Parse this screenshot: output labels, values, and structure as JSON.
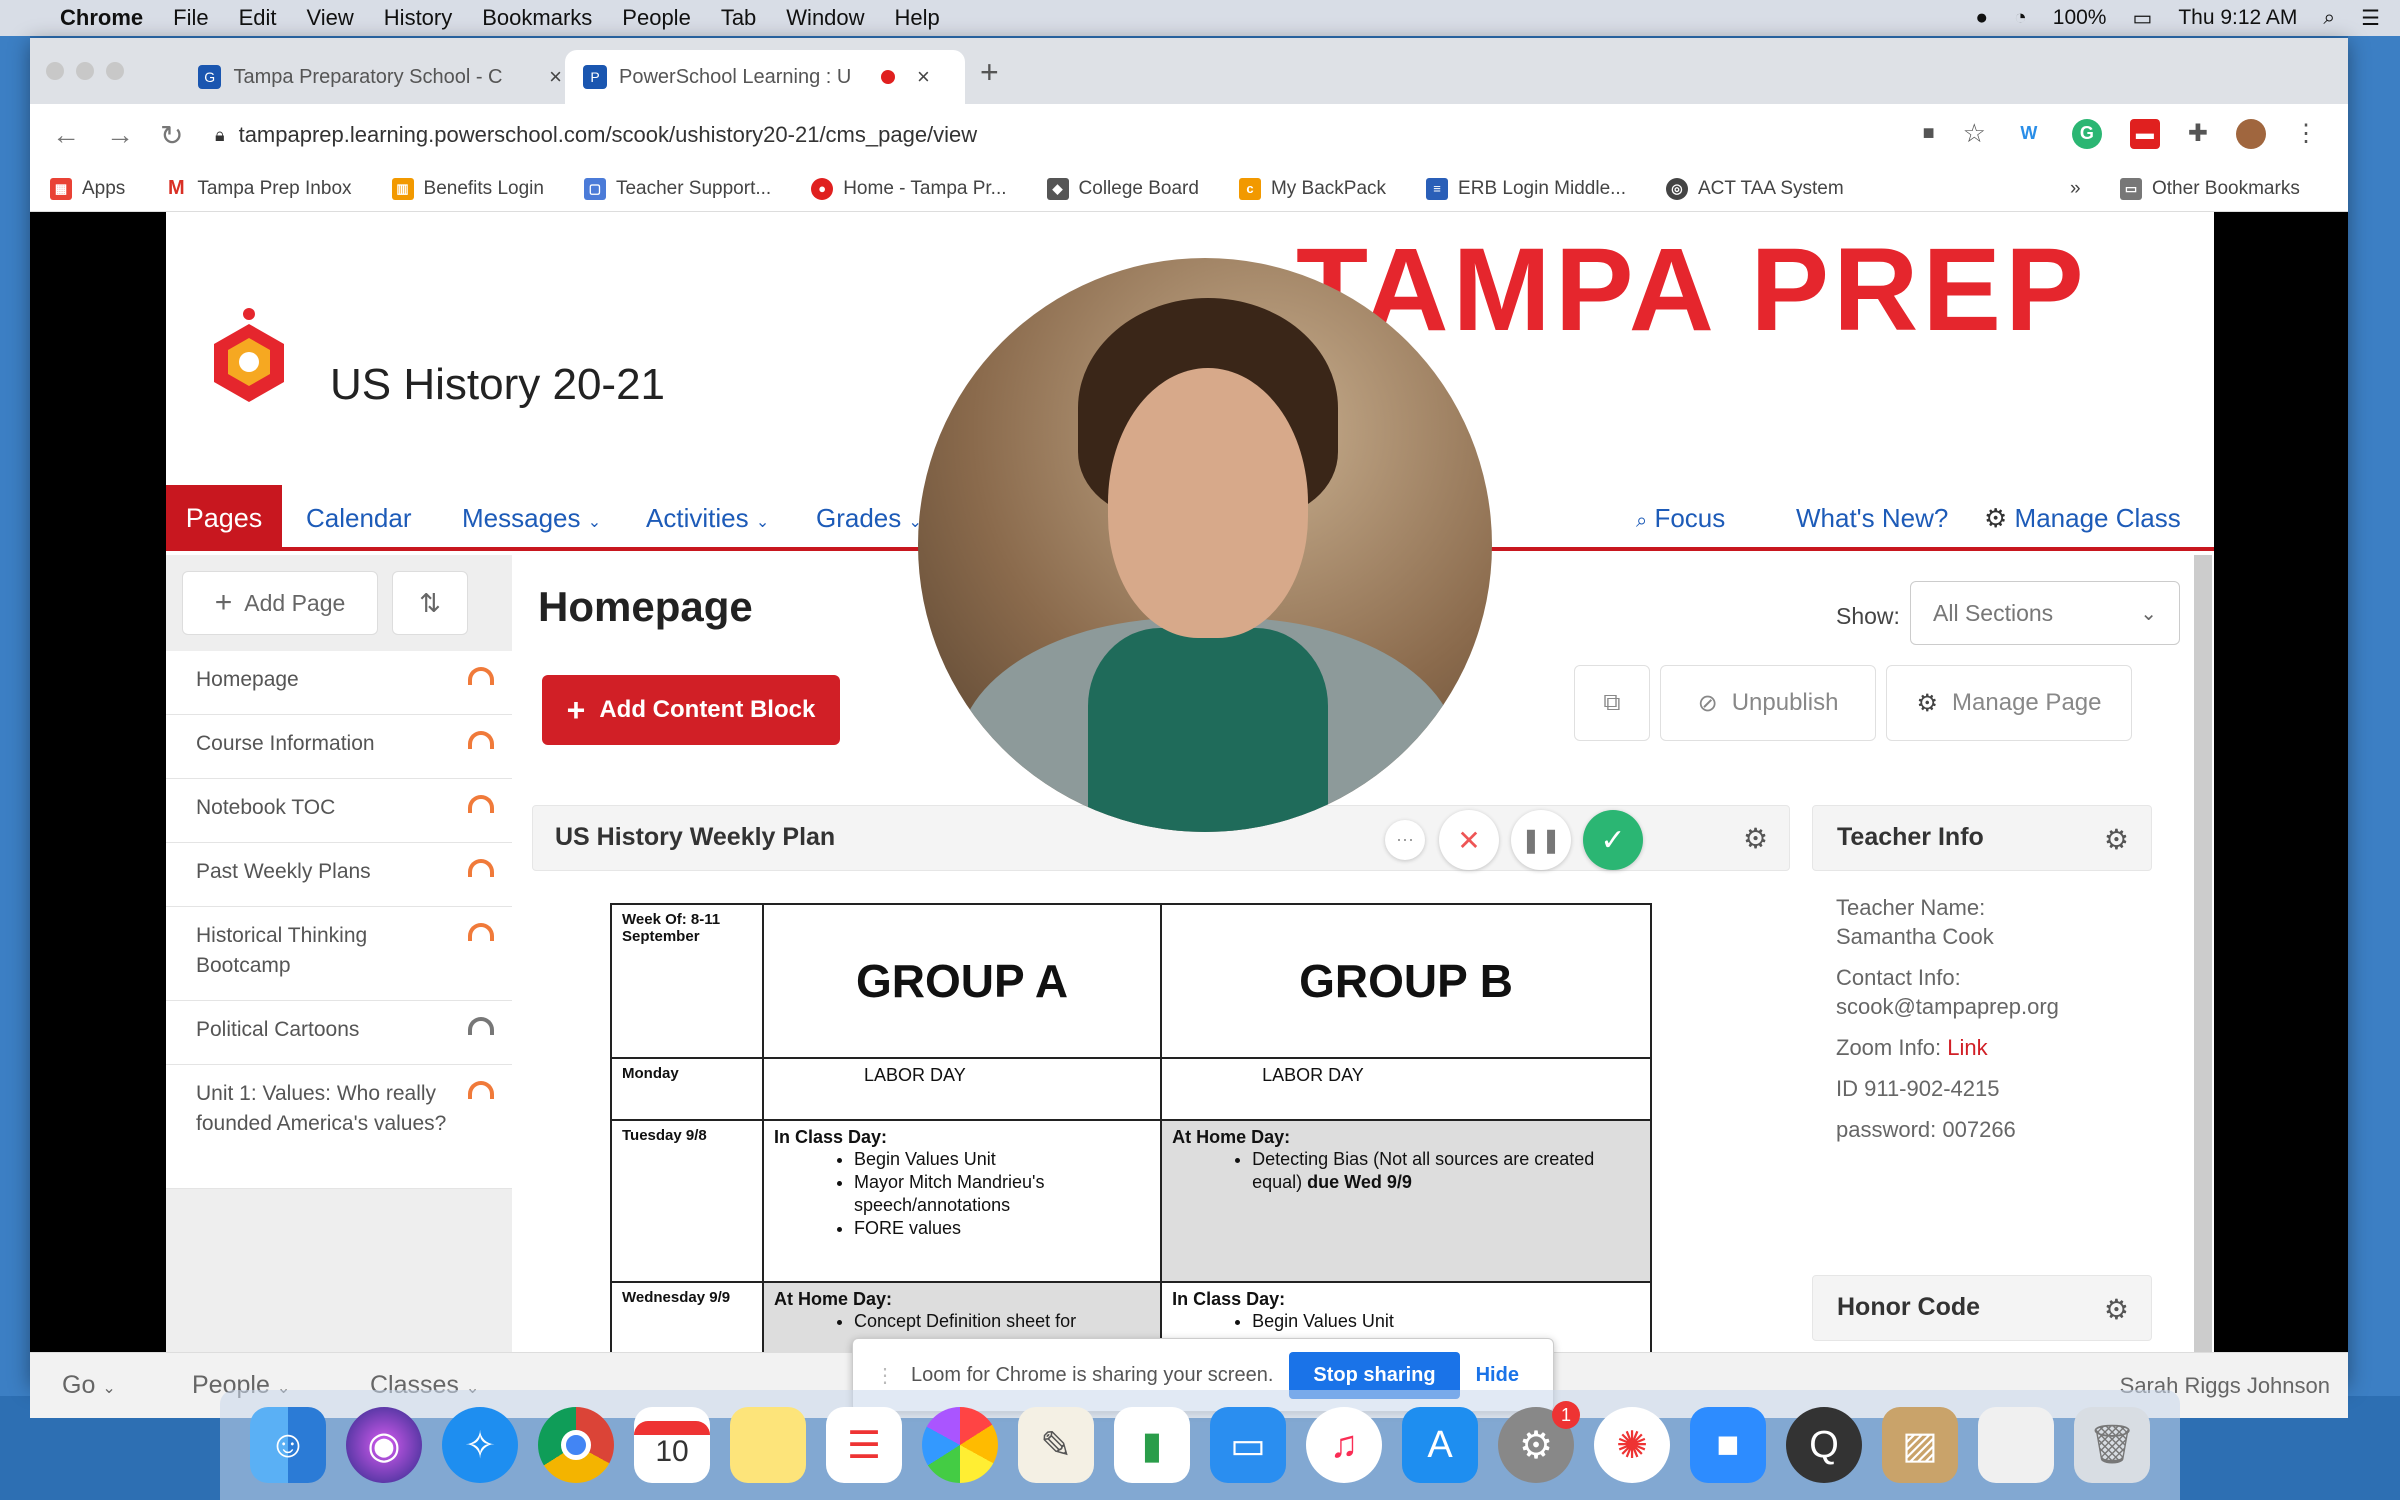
{
  "menubar": {
    "apple": "",
    "items": [
      "Chrome",
      "File",
      "Edit",
      "View",
      "History",
      "Bookmarks",
      "People",
      "Tab",
      "Window",
      "Help"
    ],
    "battery": "100%",
    "clock": "Thu 9:12 AM"
  },
  "browser": {
    "tabs": [
      {
        "title": "Tampa Preparatory School - C"
      },
      {
        "title": "PowerSchool Learning : U"
      }
    ],
    "url": "tampaprep.learning.powerschool.com/scook/ushistory20-21/cms_page/view",
    "bookmarks": [
      "Apps",
      "Tampa Prep Inbox",
      "Benefits Login",
      "Teacher Support...",
      "Home - Tampa Pr...",
      "College Board",
      "My BackPack",
      "ERB Login Middle...",
      "ACT TAA System"
    ],
    "more_bookmarks": "»",
    "other_bookmarks": "Other Bookmarks"
  },
  "site": {
    "brand": "TAMPA PREP",
    "course_title": "US History 20-21",
    "nav": {
      "pages": "Pages",
      "calendar": "Calendar",
      "messages": "Messages",
      "activities": "Activities",
      "grades": "Grades",
      "focus": "Focus",
      "whats_new": "What's New?",
      "manage_class": "Manage Class"
    },
    "sidebar": {
      "add_page": "Add Page",
      "items": [
        {
          "label": "Homepage"
        },
        {
          "label": "Course Information"
        },
        {
          "label": "Notebook TOC"
        },
        {
          "label": "Past Weekly Plans"
        },
        {
          "label": "Historical Thinking Bootcamp"
        },
        {
          "label": "Political Cartoons"
        },
        {
          "label": "Unit 1: Values: Who really founded America's values?"
        }
      ]
    },
    "main": {
      "heading": "Homepage",
      "show_label": "Show:",
      "show_value": "All Sections",
      "add_content_block": "Add Content Block",
      "unpublish": "Unpublish",
      "manage_page": "Manage Page",
      "block_title": "US History Weekly Plan"
    },
    "schedule": {
      "week_of": "Week Of: 8-11 September",
      "group_a": "GROUP A",
      "group_b": "GROUP B",
      "monday": "Monday",
      "monday_a": "LABOR DAY",
      "monday_b": "LABOR DAY",
      "tuesday": "Tuesday 9/8",
      "tuesday_a_head": "In Class Day:",
      "tuesday_a_items": [
        "Begin Values Unit",
        "Mayor Mitch Mandrieu's speech/annotations",
        "FORE values"
      ],
      "tuesday_b_head": "At Home Day:",
      "tuesday_b_item": "Detecting Bias (Not all sources are created equal)",
      "tuesday_b_due": "due Wed 9/9",
      "wednesday": "Wednesday 9/9",
      "wednesday_a_head": "At Home Day:",
      "wednesday_a_item": "Concept Definition sheet for",
      "wednesday_b_head": "In Class Day:",
      "wednesday_b_item": "Begin Values Unit"
    },
    "teacher_info": {
      "title": "Teacher Info",
      "name_label": "Teacher Name:",
      "name": "Samantha Cook",
      "contact_label": "Contact Info:",
      "email": "scook@tampaprep.org",
      "zoom_label": "Zoom Info:",
      "zoom_link": "Link",
      "id": "ID 911-902-4215",
      "password": "password: 007266"
    },
    "honor_code": {
      "title": "Honor Code"
    }
  },
  "bottombar": {
    "go": "Go",
    "people": "People",
    "classes": "Classes",
    "user": "Sarah Riggs Johnson"
  },
  "loom": {
    "message": "Loom for Chrome is sharing your screen.",
    "stop": "Stop sharing",
    "hide": "Hide"
  },
  "dock": {
    "calendar_day": "10",
    "badge": "1"
  },
  "colors": {
    "brand_red": "#c8171f",
    "link_blue": "#1d5bb8",
    "loom_green": "#2bb673"
  }
}
